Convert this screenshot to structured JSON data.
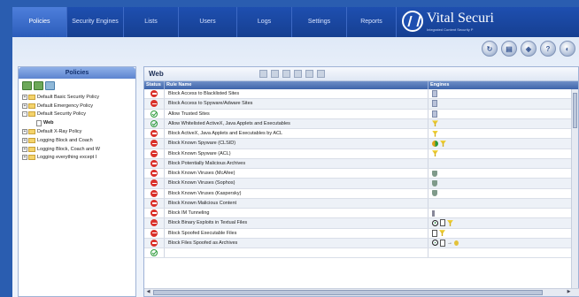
{
  "nav": {
    "tabs": [
      {
        "label": "Policies",
        "active": true
      },
      {
        "label": "Security Engines",
        "active": false
      },
      {
        "label": "Lists",
        "active": false
      },
      {
        "label": "Users",
        "active": false
      },
      {
        "label": "Logs",
        "active": false
      },
      {
        "label": "Settings",
        "active": false
      },
      {
        "label": "Reports",
        "active": false
      }
    ],
    "brand_name": "Vital Securi",
    "brand_tagline": "Integrated Content Security P"
  },
  "left_panel": {
    "title": "Policies",
    "tree": [
      {
        "label": "Default Basic Security Policy",
        "level": 0,
        "expander": "+"
      },
      {
        "label": "Default Emergency Policy",
        "level": 0,
        "expander": "+"
      },
      {
        "label": "Default Security Policy",
        "level": 0,
        "expander": "-"
      },
      {
        "label": "Web",
        "level": 1,
        "selected": true
      },
      {
        "label": "Default X-Ray Policy",
        "level": 0,
        "expander": "+"
      },
      {
        "label": "Logging Block and Coach",
        "level": 0,
        "expander": "+"
      },
      {
        "label": "Logging Block, Coach and W",
        "level": 0,
        "expander": "+"
      },
      {
        "label": "Logging everything except I",
        "level": 0,
        "expander": "+"
      }
    ]
  },
  "right_panel": {
    "title": "Web",
    "columns": {
      "status": "Status",
      "rule_name": "Rule Name",
      "engines": "Engines"
    },
    "rows": [
      {
        "status": "block",
        "name": "Block Access to Blacklisted Sites",
        "engines": [
          "doc-icon"
        ]
      },
      {
        "status": "block",
        "name": "Block Access to Spyware/Adware Sites",
        "engines": [
          "doc-icon"
        ]
      },
      {
        "status": "allow",
        "name": "Allow Trusted Sites",
        "engines": [
          "doc-icon"
        ]
      },
      {
        "status": "allow",
        "name": "Allow Whitelisted ActiveX, Java Applets and Executables",
        "engines": [
          "funnel-icon"
        ]
      },
      {
        "status": "block",
        "name": "Block ActiveX, Java Applets and Executables by ACL",
        "engines": [
          "funnel-icon"
        ]
      },
      {
        "status": "block",
        "name": "Block Known Spyware (CLSID)",
        "engines": [
          "globe-icon",
          "funnel-icon"
        ]
      },
      {
        "status": "block",
        "name": "Block Known Spyware (ACL)",
        "engines": [
          "funnel-icon"
        ]
      },
      {
        "status": "block",
        "name": "Block Potentially Malicious Archives",
        "engines": []
      },
      {
        "status": "block",
        "name": "Block Known Viruses (McAfee)",
        "engines": [
          "shield-icon"
        ]
      },
      {
        "status": "block",
        "name": "Block Known Viruses (Sophos)",
        "engines": [
          "shield-icon"
        ]
      },
      {
        "status": "block",
        "name": "Block Known Viruses (Kaspersky)",
        "engines": [
          "shield-icon"
        ]
      },
      {
        "status": "block",
        "name": "Block Known Malicious Content",
        "engines": []
      },
      {
        "status": "block",
        "name": "Block IM Tunneling",
        "engines": [
          "bar-icon"
        ]
      },
      {
        "status": "block",
        "name": "Block Binary Exploits in Textual Files",
        "engines": [
          "gauge-icon",
          "page-icon",
          "funnel-icon"
        ]
      },
      {
        "status": "block",
        "name": "Block Spoofed Executable Files",
        "engines": [
          "page-icon",
          "funnel-icon"
        ]
      },
      {
        "status": "block",
        "name": "Block Files Spoofed as Archives",
        "engines": [
          "gauge-icon",
          "page-icon",
          "arrow-icon",
          "key-icon"
        ]
      },
      {
        "status": "allow",
        "name": "",
        "engines": []
      }
    ]
  },
  "colors": {
    "nav_bg": "#1e4fb0",
    "block_status": "#d9302a",
    "allow_status": "#2c9a3a"
  }
}
